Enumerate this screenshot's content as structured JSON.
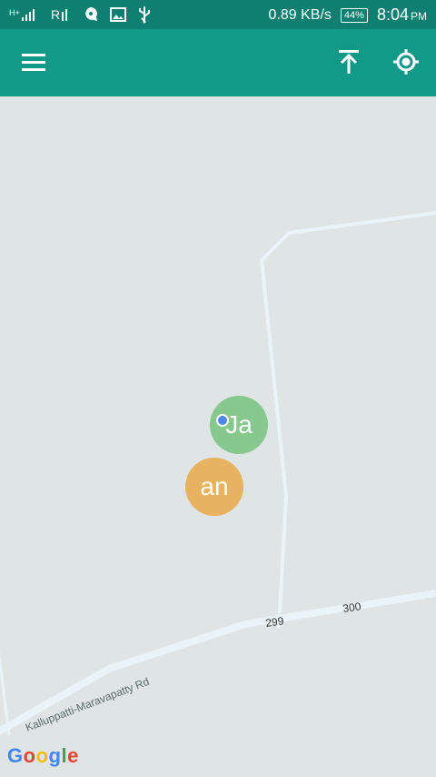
{
  "statusbar": {
    "network_speed": "0.89 KB/s",
    "battery": "44%",
    "time": "8:04",
    "ampm": "PM"
  },
  "appbar": {
    "menu_icon": "menu-icon",
    "upload_icon": "arrow-to-top-icon",
    "locate_icon": "my-location-icon"
  },
  "map": {
    "road_name": "Kalluppatti-Maravapatty Rd",
    "road_marker_1": "299",
    "road_marker_2": "300",
    "clusters": [
      {
        "label": "Ja",
        "color": "#86c88d"
      },
      {
        "label": "an",
        "color": "#e7b361"
      }
    ],
    "attribution": "Google",
    "colors": {
      "appbar": "#129a89",
      "statusbar": "#0f7f72",
      "map_bg": "#dfe5e4",
      "road": "#eef6fb"
    }
  }
}
